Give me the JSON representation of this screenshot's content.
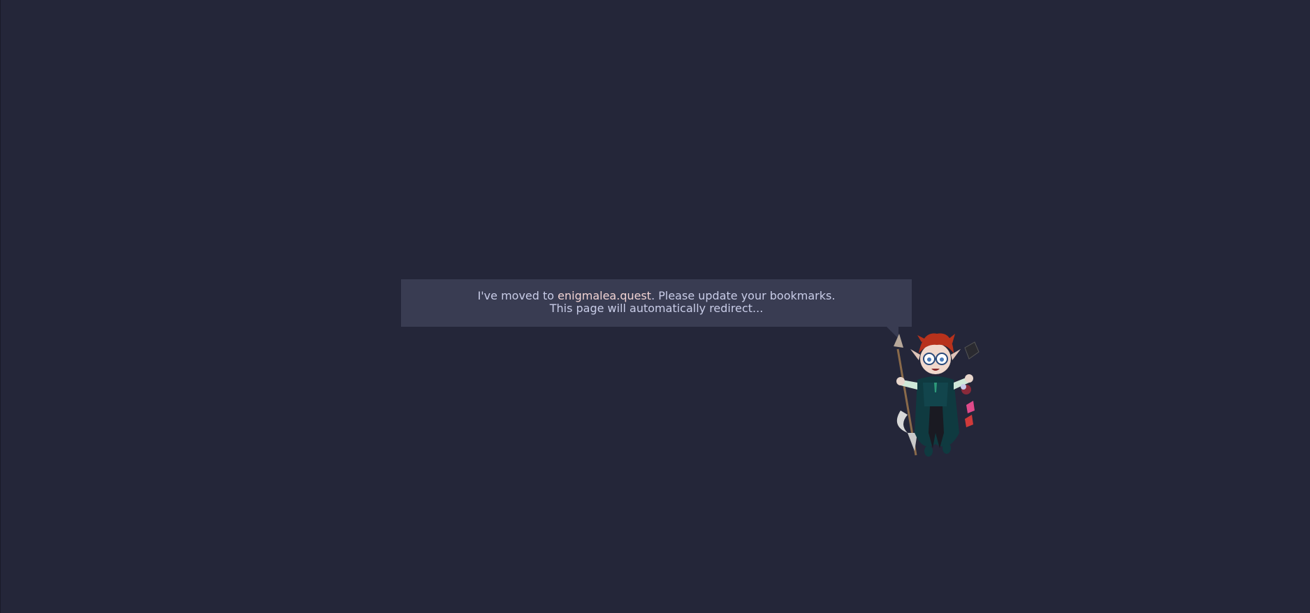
{
  "message": {
    "line1_prefix": "I've moved to ",
    "link_text": "enigmalea.quest",
    "line1_suffix": ". Please update your bookmarks.",
    "line2": "This page will automatically redirect..."
  },
  "colors": {
    "background": "#242639",
    "bubble": "#393c52",
    "text": "#c9cde8",
    "link": "#f2d4d4"
  },
  "mascot": {
    "icon": "chibi-character-illustration"
  }
}
